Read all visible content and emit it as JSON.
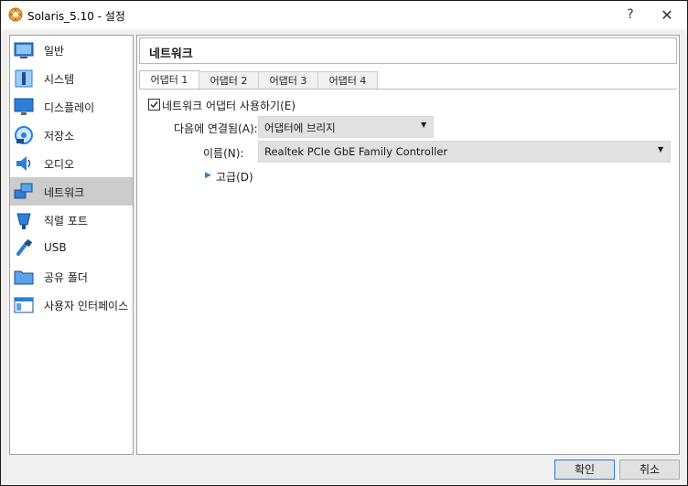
{
  "window": {
    "title": "Solaris_5.10 - 설정",
    "help": "?",
    "close": "✕"
  },
  "sidebar": {
    "items": [
      {
        "label": "일반",
        "icon": "general-icon"
      },
      {
        "label": "시스템",
        "icon": "system-icon"
      },
      {
        "label": "디스플레이",
        "icon": "display-icon"
      },
      {
        "label": "저장소",
        "icon": "storage-icon"
      },
      {
        "label": "오디오",
        "icon": "audio-icon"
      },
      {
        "label": "네트워크",
        "icon": "network-icon",
        "selected": true
      },
      {
        "label": "직렬 포트",
        "icon": "serial-port-icon"
      },
      {
        "label": "USB",
        "icon": "usb-icon"
      },
      {
        "label": "공유 폴더",
        "icon": "shared-folder-icon"
      },
      {
        "label": "사용자 인터페이스",
        "icon": "user-interface-icon"
      }
    ]
  },
  "page": {
    "title": "네트워크",
    "tabs": [
      "어댑터 1",
      "어댑터 2",
      "어댑터 3",
      "어댑터 4"
    ],
    "active_tab": "어댑터 1",
    "enable_adapter_label": "네트워크 어댑터 사용하기(E)",
    "enable_adapter_checked": "✓",
    "attached_to_label": "다음에 연결됨(A):",
    "attached_to_value": "어댑터에 브리지",
    "name_label": "이름(N):",
    "name_value": "Realtek PCIe GbE Family Controller",
    "advanced_label": "고급(D)"
  },
  "buttons": {
    "ok": "확인",
    "cancel": "취소"
  },
  "colors": {
    "accent": "#2a7bd6",
    "selected_bg": "#cccccc",
    "window_bg": "#f0f0f0"
  }
}
